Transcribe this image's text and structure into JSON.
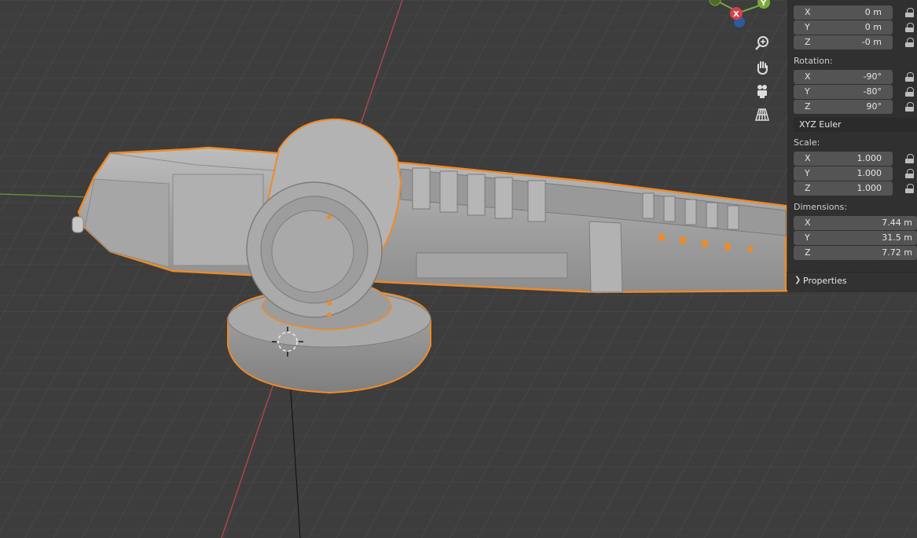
{
  "gizmo": {
    "x_label": "X",
    "y_label": "Y"
  },
  "colors": {
    "selection": "#f08a24",
    "axis_x": "#d6414d",
    "axis_y": "#7aa93a",
    "panel_bg": "#303030",
    "field_bg": "#545454"
  },
  "nav_icons": [
    "zoom-icon",
    "hand-pan-icon",
    "camera-icon",
    "perspective-grid-icon"
  ],
  "location": {
    "rows": [
      {
        "axis": "X",
        "value": "0 m"
      },
      {
        "axis": "Y",
        "value": "0 m"
      },
      {
        "axis": "Z",
        "value": "-0 m"
      }
    ]
  },
  "rotation": {
    "label": "Rotation:",
    "rows": [
      {
        "axis": "X",
        "value": "-90°"
      },
      {
        "axis": "Y",
        "value": "-80°"
      },
      {
        "axis": "Z",
        "value": "90°"
      }
    ],
    "mode": "XYZ Euler"
  },
  "scale": {
    "label": "Scale:",
    "rows": [
      {
        "axis": "X",
        "value": "1.000"
      },
      {
        "axis": "Y",
        "value": "1.000"
      },
      {
        "axis": "Z",
        "value": "1.000"
      }
    ]
  },
  "dimensions": {
    "label": "Dimensions:",
    "rows": [
      {
        "axis": "X",
        "value": "7.44 m"
      },
      {
        "axis": "Y",
        "value": "31.5 m"
      },
      {
        "axis": "Z",
        "value": "7.72 m"
      }
    ]
  },
  "properties": {
    "label": "Properties"
  }
}
